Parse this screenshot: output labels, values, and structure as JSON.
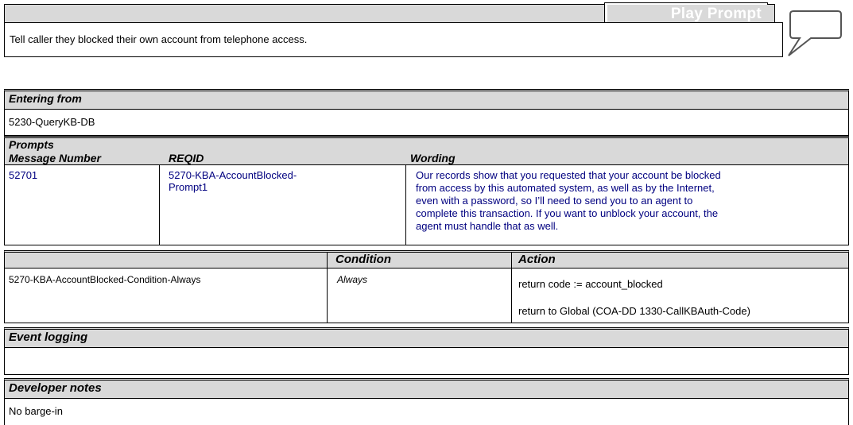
{
  "header": {
    "title": "Play Prompt",
    "description": "Tell caller they blocked their own account from telephone access.",
    "speech_icon": "speech-bubble-icon"
  },
  "entering_from": {
    "heading": "Entering from",
    "value": "5230-QueryKB-DB"
  },
  "prompts": {
    "heading": "Prompts",
    "columns": [
      "Message Number",
      "REQID",
      "Wording"
    ],
    "rows": [
      {
        "message_number": "52701",
        "reqid_line1": "5270-KBA-AccountBlocked-",
        "reqid_line2": "Prompt1",
        "wording_lines": [
          "Our records show that you requested that your account be blocked",
          "from access by this automated system, as well as by the Internet,",
          "even with a password, so I’ll need to send you to an agent to",
          "complete this transaction. If you want to unblock your account, the",
          "agent must handle that as well."
        ]
      }
    ]
  },
  "conditions": {
    "columns": [
      "",
      "Condition",
      "Action"
    ],
    "row": {
      "name": "5270-KBA-AccountBlocked-Condition-Always",
      "condition": "Always",
      "action_1": "return code := account_blocked",
      "action_2": "return to Global (COA-DD 1330-CallKBAuth-Code)"
    }
  },
  "event_logging": {
    "heading": "Event logging",
    "value": ""
  },
  "developer_notes": {
    "heading": "Developer notes",
    "value": "No barge-in"
  }
}
